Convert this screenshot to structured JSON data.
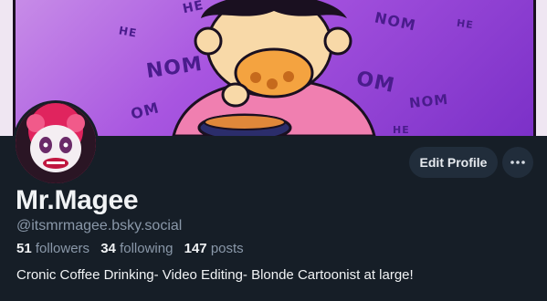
{
  "profile": {
    "display_name": "Mr.Magee",
    "handle": "@itsmrmagee.bsky.social",
    "bio": "Cronic Coffee Drinking- Video Editing- Blonde Cartoonist at large!",
    "followers_count": "51",
    "followers_label": "followers",
    "following_count": "34",
    "following_label": "following",
    "posts_count": "147",
    "posts_label": "posts"
  },
  "actions": {
    "edit_profile_label": "Edit Profile",
    "more_icon": "ellipsis-icon"
  },
  "banner": {
    "sfx_nom": "NOM",
    "sfx_he": "HE",
    "sfx_om": "OM"
  },
  "colors": {
    "background": "#161e27",
    "button_bg": "#212d3b",
    "text_primary": "#f1f3f5",
    "text_secondary": "#8a98a9",
    "banner_purple": "#a855e0"
  }
}
